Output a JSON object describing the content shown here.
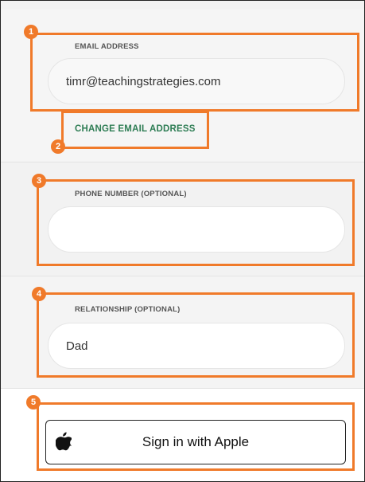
{
  "email": {
    "label": "EMAIL ADDRESS",
    "value": "timr@teachingstrategies.com",
    "change_link": "CHANGE EMAIL ADDRESS"
  },
  "phone": {
    "label": "PHONE NUMBER (OPTIONAL)",
    "value": ""
  },
  "relationship": {
    "label": "RELATIONSHIP (OPTIONAL)",
    "value": "Dad"
  },
  "apple": {
    "label": "Sign in with Apple",
    "icon": "apple-icon"
  },
  "callouts": [
    "1",
    "2",
    "3",
    "4",
    "5"
  ],
  "colors": {
    "callout": "#f07a2a",
    "link": "#2e7d54"
  }
}
